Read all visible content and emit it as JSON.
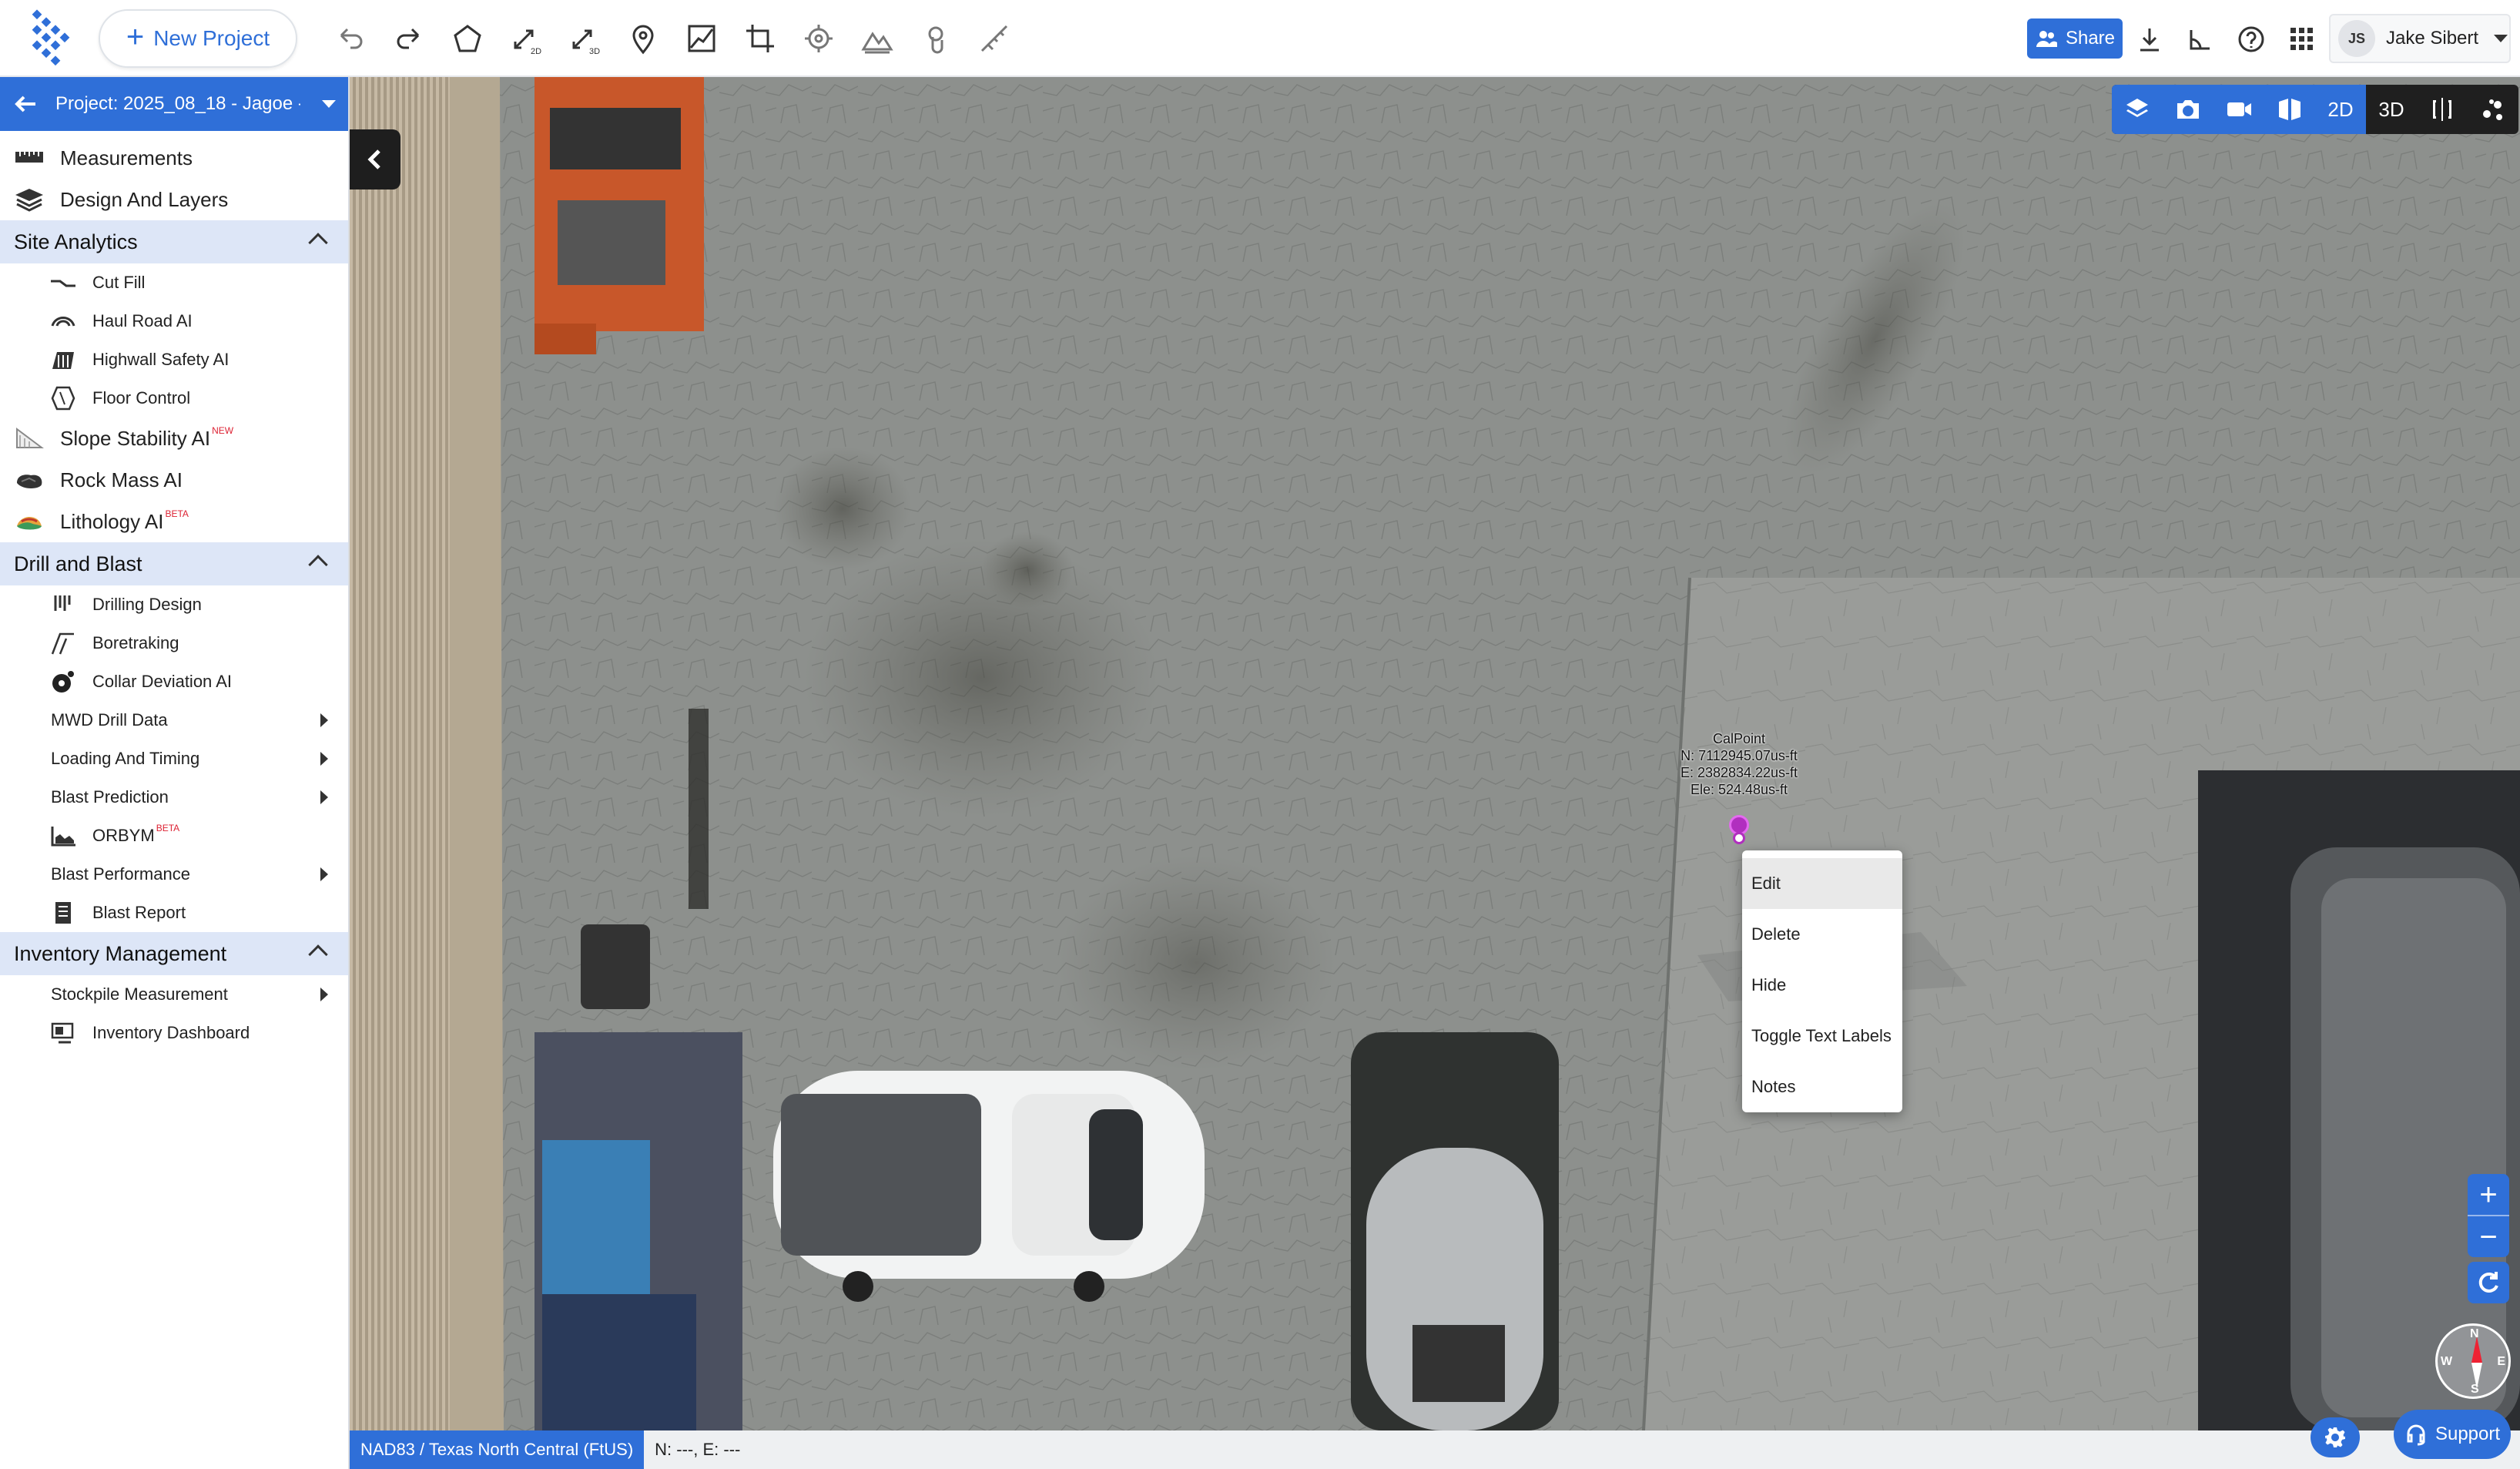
{
  "toolbar": {
    "new_project_label": "New Project",
    "tools": [
      "undo-icon",
      "redo-icon",
      "polygon-icon",
      "measure-2d-icon",
      "measure-3d-icon",
      "location-pin-icon",
      "profile-icon",
      "crop-icon",
      "target-icon",
      "terrain-icon",
      "touch-icon",
      "ruler-icon"
    ],
    "tool_2d_label": "2D",
    "tool_3d_label": "3D",
    "share_label": "Share",
    "user": {
      "initials": "JS",
      "name": "Jake Sibert"
    }
  },
  "sidebar": {
    "project_label": "Project: 2025_08_18 - Jagoe -...",
    "top_items": [
      {
        "label": "Measurements",
        "icon": "ruler-icon"
      },
      {
        "label": "Design And Layers",
        "icon": "layers-icon"
      }
    ],
    "site_analytics": {
      "title": "Site Analytics",
      "items": [
        {
          "label": "Cut Fill",
          "icon": "cut-fill-icon"
        },
        {
          "label": "Haul Road AI",
          "icon": "haul-road-icon"
        },
        {
          "label": "Highwall Safety AI",
          "icon": "highwall-icon"
        },
        {
          "label": "Floor Control",
          "icon": "floor-control-icon"
        }
      ]
    },
    "ai_items": [
      {
        "label": "Slope Stability AI",
        "tag": "NEW",
        "icon": "slope-icon"
      },
      {
        "label": "Rock Mass AI",
        "tag": "",
        "icon": "rock-icon"
      },
      {
        "label": "Lithology AI",
        "tag": "BETA",
        "icon": "lithology-icon"
      }
    ],
    "drill_blast": {
      "title": "Drill and Blast",
      "items": [
        {
          "label": "Drilling Design",
          "icon": "drilling-icon",
          "submenu": false
        },
        {
          "label": "Boretraking",
          "icon": "bore-icon",
          "submenu": false
        },
        {
          "label": "Collar Deviation AI",
          "icon": "collar-icon",
          "submenu": false
        },
        {
          "label": "MWD Drill Data",
          "icon": "",
          "submenu": true
        },
        {
          "label": "Loading And Timing",
          "icon": "",
          "submenu": true
        },
        {
          "label": "Blast Prediction",
          "icon": "",
          "submenu": true
        },
        {
          "label": "ORBYM",
          "tag": "BETA",
          "icon": "orbym-icon",
          "submenu": false
        },
        {
          "label": "Blast Performance",
          "icon": "",
          "submenu": true
        },
        {
          "label": "Blast Report",
          "icon": "report-icon",
          "submenu": false
        }
      ]
    },
    "inventory": {
      "title": "Inventory Management",
      "items": [
        {
          "label": "Stockpile Measurement",
          "icon": "",
          "submenu": true
        },
        {
          "label": "Inventory Dashboard",
          "icon": "dashboard-icon",
          "submenu": false
        }
      ]
    }
  },
  "viewbar": {
    "btn_2d": "2D",
    "btn_3d": "3D"
  },
  "calpoint": {
    "name": "CalPoint",
    "north": "N: 7112945.07us-ft",
    "east": "E: 2382834.22us-ft",
    "elevation": "Ele: 524.48us-ft",
    "pin_color": "#b12fbf"
  },
  "context_menu": {
    "items": [
      "Edit",
      "Delete",
      "Hide",
      "Toggle Text Labels",
      "Notes"
    ],
    "active_index": 0
  },
  "compass": {
    "n": "N",
    "e": "E",
    "s": "S",
    "w": "W"
  },
  "status": {
    "crs": "NAD83 / Texas North Central (FtUS)",
    "coords": "N: ---, E: ---"
  },
  "support_label": "Support",
  "colors": {
    "accent": "#2f6fd8",
    "section_bg": "#dde6f7"
  }
}
